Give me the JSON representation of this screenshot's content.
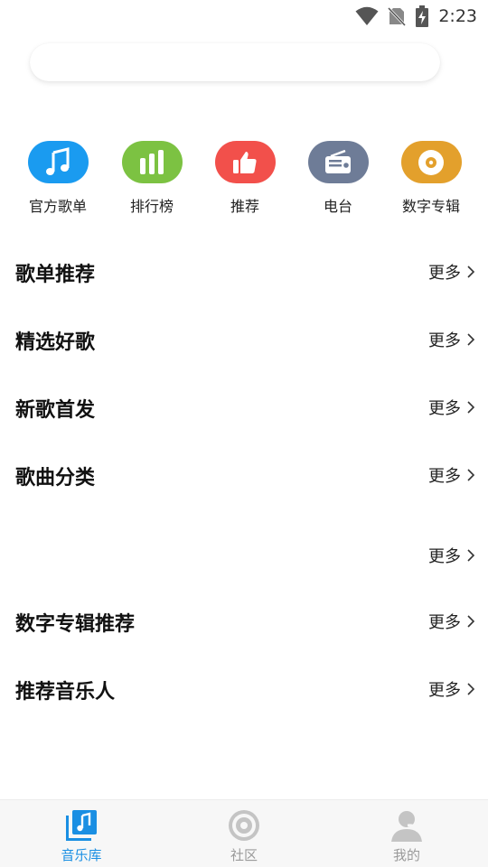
{
  "status_bar": {
    "time": "2:23"
  },
  "search": {
    "placeholder": ""
  },
  "quick_entries": [
    {
      "label": "官方歌单",
      "color": "#1a9bf0",
      "icon": "music-note-icon"
    },
    {
      "label": "排行榜",
      "color": "#7cc242",
      "icon": "bar-chart-icon"
    },
    {
      "label": "推荐",
      "color": "#f2504b",
      "icon": "thumbs-up-icon"
    },
    {
      "label": "电台",
      "color": "#6e7c97",
      "icon": "radio-icon"
    },
    {
      "label": "数字专辑",
      "color": "#e3a02c",
      "icon": "disc-icon"
    }
  ],
  "sections": [
    {
      "title": "歌单推荐",
      "more": "更多"
    },
    {
      "title": "精选好歌",
      "more": "更多"
    },
    {
      "title": "新歌首发",
      "more": "更多"
    },
    {
      "title": "歌曲分类",
      "more": "更多"
    },
    {
      "title": "",
      "more": "更多"
    },
    {
      "title": "数字专辑推荐",
      "more": "更多"
    },
    {
      "title": "推荐音乐人",
      "more": "更多"
    }
  ],
  "bottom_nav": [
    {
      "label": "音乐库",
      "active": true,
      "icon": "music-library-icon"
    },
    {
      "label": "社区",
      "active": false,
      "icon": "community-icon"
    },
    {
      "label": "我的",
      "active": false,
      "icon": "profile-icon"
    }
  ],
  "colors": {
    "accent": "#1a8fe3",
    "inactive": "#9a9a9a"
  }
}
